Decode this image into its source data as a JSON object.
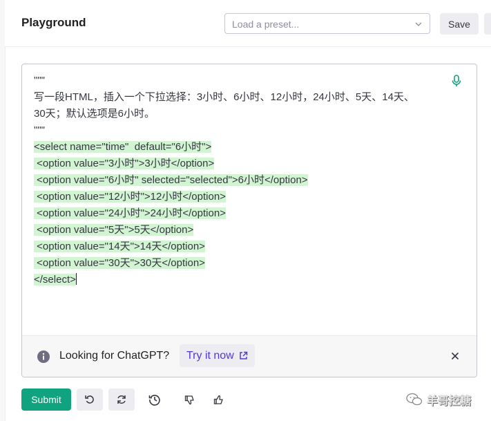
{
  "header": {
    "title": "Playground",
    "preset_placeholder": "Load a preset...",
    "save_label": "Save"
  },
  "editor": {
    "prompt_lines": [
      "\"\"\"",
      "写一段HTML，插入一个下拉选择：3小时、6小时、12小时，24小时、5天、14天、",
      "30天；默认选项是6小时。",
      "\"\"\""
    ],
    "generated_lines": [
      "<select name=\"time\"  default=\"6小时\">",
      " <option value=\"3小时\">3小时</option>",
      " <option value=\"6小时\" selected=\"selected\">6小时</option>",
      " <option value=\"12小时\">12小时</option>",
      " <option value=\"24小时\">24小时</option>",
      " <option value=\"5天\">5天</option>",
      " <option value=\"14天\">14天</option>",
      " <option value=\"30天\">30天</option>",
      "</select>"
    ]
  },
  "banner": {
    "text": "Looking for ChatGPT?",
    "try_label": "Try it now"
  },
  "footer": {
    "submit_label": "Submit"
  },
  "watermark": "羊哥控糖",
  "colors": {
    "accent": "#10a37f",
    "highlight": "#d2f4d3",
    "link": "#5436da"
  }
}
